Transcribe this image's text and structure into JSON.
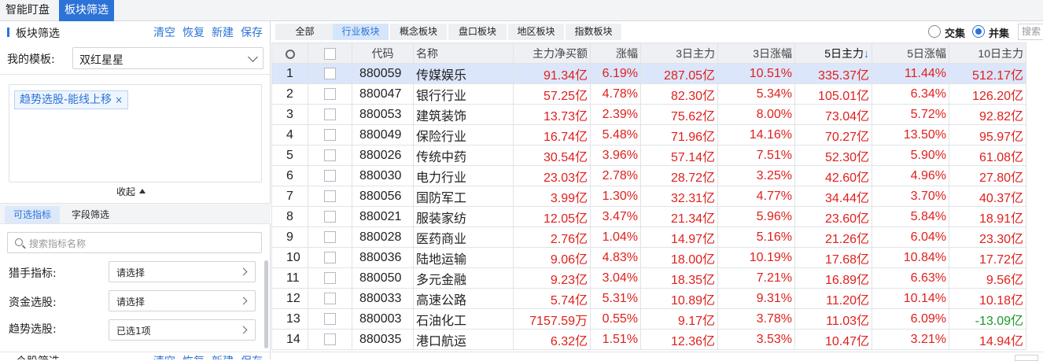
{
  "top_tabs": [
    "智能盯盘",
    "板块筛选"
  ],
  "left": {
    "title": "板块筛选",
    "actions": [
      "清空",
      "恢复",
      "新建",
      "保存"
    ],
    "template_label": "我的模板:",
    "template_value": "双红星星",
    "tag": "趋势选股-能线上移",
    "collapse": "收起",
    "sub_tabs": [
      "可选指标",
      "字段筛选"
    ],
    "search_placeholder": "搜索指标名称",
    "fields": [
      {
        "label": "猎手指标:",
        "value": "请选择"
      },
      {
        "label": "资金选股:",
        "value": "请选择"
      },
      {
        "label": "趋势选股:",
        "value": "已选1项"
      }
    ],
    "footer_title": "个股筛选",
    "footer_actions": [
      "清空",
      "恢复",
      "新建",
      "保存"
    ]
  },
  "right": {
    "categories": [
      "全部",
      "行业板块",
      "概念板块",
      "盘口板块",
      "地区板块",
      "指数板块"
    ],
    "radios": [
      "交集",
      "并集"
    ],
    "search_placeholder": "搜索",
    "columns": [
      "",
      "",
      "代码",
      "名称",
      "主力净买额",
      "涨幅",
      "3日主力",
      "3日涨幅",
      "5日主力",
      "5日涨幅",
      "10日主力"
    ],
    "sort_marker": "↓",
    "rows": [
      [
        "1",
        "880059",
        "传媒娱乐",
        "91.34亿",
        "6.19%",
        "287.05亿",
        "10.51%",
        "335.37亿",
        "11.44%",
        "512.17亿"
      ],
      [
        "2",
        "880047",
        "银行行业",
        "57.25亿",
        "4.78%",
        "82.30亿",
        "5.34%",
        "105.01亿",
        "6.34%",
        "126.20亿"
      ],
      [
        "3",
        "880053",
        "建筑装饰",
        "13.73亿",
        "2.39%",
        "75.62亿",
        "8.00%",
        "73.04亿",
        "5.72%",
        "92.82亿"
      ],
      [
        "4",
        "880049",
        "保险行业",
        "16.74亿",
        "5.48%",
        "71.96亿",
        "14.16%",
        "70.27亿",
        "13.50%",
        "95.97亿"
      ],
      [
        "5",
        "880026",
        "传统中药",
        "30.54亿",
        "3.96%",
        "57.14亿",
        "7.51%",
        "52.30亿",
        "5.90%",
        "61.08亿"
      ],
      [
        "6",
        "880030",
        "电力行业",
        "23.03亿",
        "2.78%",
        "28.72亿",
        "3.25%",
        "42.60亿",
        "4.96%",
        "27.80亿"
      ],
      [
        "7",
        "880056",
        "国防军工",
        "3.99亿",
        "1.30%",
        "32.31亿",
        "4.77%",
        "34.44亿",
        "3.70%",
        "40.37亿"
      ],
      [
        "8",
        "880021",
        "服装家纺",
        "12.05亿",
        "3.47%",
        "21.34亿",
        "5.96%",
        "23.60亿",
        "5.84%",
        "18.91亿"
      ],
      [
        "9",
        "880028",
        "医药商业",
        "2.76亿",
        "1.04%",
        "14.97亿",
        "5.16%",
        "21.26亿",
        "6.04%",
        "23.30亿"
      ],
      [
        "10",
        "880036",
        "陆地运输",
        "9.06亿",
        "4.83%",
        "18.00亿",
        "10.19%",
        "17.68亿",
        "10.84%",
        "17.72亿"
      ],
      [
        "11",
        "880050",
        "多元金融",
        "9.23亿",
        "3.04%",
        "18.35亿",
        "7.21%",
        "16.89亿",
        "6.63%",
        "9.56亿"
      ],
      [
        "12",
        "880033",
        "高速公路",
        "5.74亿",
        "5.31%",
        "10.89亿",
        "9.31%",
        "11.20亿",
        "10.14%",
        "10.18亿"
      ],
      [
        "13",
        "880003",
        "石油化工",
        "7157.59万",
        "0.55%",
        "9.17亿",
        "3.78%",
        "11.03亿",
        "6.09%",
        "-13.09亿"
      ],
      [
        "14",
        "880035",
        "港口航运",
        "6.32亿",
        "1.51%",
        "12.36亿",
        "3.53%",
        "10.47亿",
        "3.21%",
        "14.94亿"
      ]
    ]
  }
}
